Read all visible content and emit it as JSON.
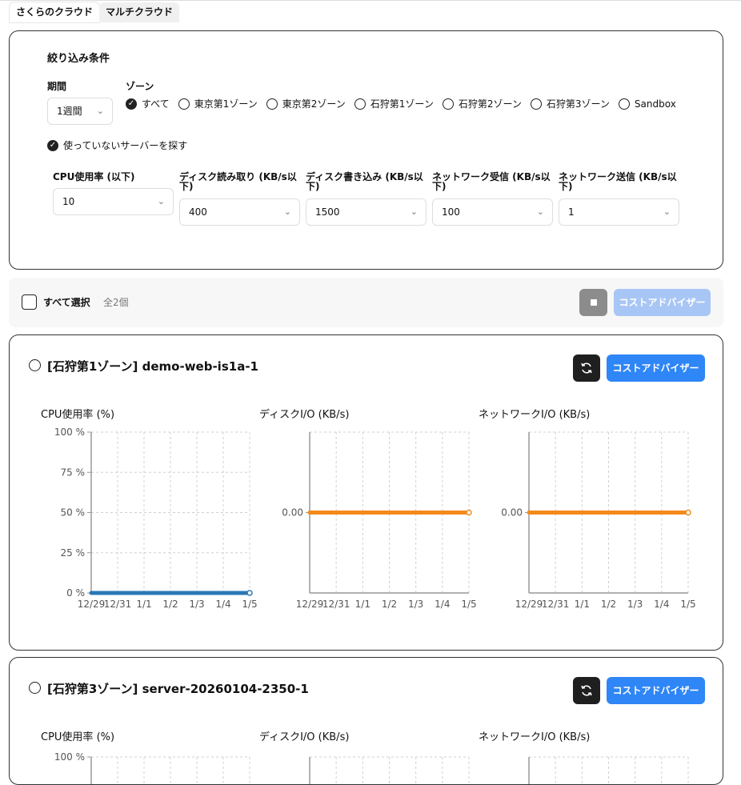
{
  "tabs": [
    {
      "label": "さくらのクラウド",
      "active": true
    },
    {
      "label": "マルチクラウド",
      "active": false
    }
  ],
  "filters": {
    "title": "絞り込み条件",
    "period": {
      "label": "期間",
      "value": "1週間"
    },
    "zone": {
      "label": "ゾーン",
      "options": [
        {
          "label": "すべて",
          "checked": true
        },
        {
          "label": "東京第1ゾーン",
          "checked": false
        },
        {
          "label": "東京第2ゾーン",
          "checked": false
        },
        {
          "label": "石狩第1ゾーン",
          "checked": false
        },
        {
          "label": "石狩第2ゾーン",
          "checked": false
        },
        {
          "label": "石狩第3ゾーン",
          "checked": false
        },
        {
          "label": "Sandbox",
          "checked": false
        }
      ]
    },
    "unused_servers": {
      "label": "使っていないサーバーを探す",
      "checked": true
    },
    "thresholds": [
      {
        "label_line1": "CPU使用率 (以下)",
        "label_line2": "",
        "value": "10"
      },
      {
        "label_line1": "ディスク読み取り (KB/s以",
        "label_line2": "下)",
        "value": "400"
      },
      {
        "label_line1": "ディスク書き込み (KB/s以",
        "label_line2": "下)",
        "value": "1500"
      },
      {
        "label_line1": "ネットワーク受信 (KB/s以",
        "label_line2": "下)",
        "value": "100"
      },
      {
        "label_line1": "ネットワーク送信 (KB/s以",
        "label_line2": "下)",
        "value": "1"
      }
    ]
  },
  "bulk": {
    "select_all_label": "すべて選択",
    "count_label": "全2個",
    "advisor_label": "コストアドバイザー"
  },
  "servers": [
    {
      "title": "[石狩第1ゾーン] demo-web-is1a-1",
      "advisor_label": "コストアドバイザー",
      "charts": [
        {
          "title": "CPU使用率 (%)",
          "y_ticks": [
            "100 %",
            "75 %",
            "50 %",
            "25 %",
            "0 %"
          ],
          "value": 0
        },
        {
          "title": "ディスクI/O (KB/s)",
          "y_ticks": [
            "0.00"
          ],
          "value": 0
        },
        {
          "title": "ネットワークI/O (KB/s)",
          "y_ticks": [
            "0.00"
          ],
          "value": 0
        }
      ]
    },
    {
      "title": "[石狩第3ゾーン] server-20260104-2350-1",
      "advisor_label": "コストアドバイザー",
      "charts": [
        {
          "title": "CPU使用率 (%)",
          "y_ticks": [
            "100 %"
          ]
        },
        {
          "title": "ディスクI/O (KB/s)",
          "y_ticks": []
        },
        {
          "title": "ネットワークI/O (KB/s)",
          "y_ticks": []
        }
      ]
    }
  ],
  "chart_data": [
    {
      "type": "line",
      "title": "CPU使用率 (%)",
      "x": [
        "12/29",
        "12/31",
        "1/1",
        "1/2",
        "1/3",
        "1/4",
        "1/5"
      ],
      "series": [
        {
          "values": [
            0,
            0,
            0,
            0,
            0,
            0,
            0
          ],
          "color": "#2a78b6"
        }
      ],
      "ylim": [
        0,
        100
      ]
    },
    {
      "type": "line",
      "title": "ディスクI/O (KB/s)",
      "x": [
        "12/29",
        "12/31",
        "1/1",
        "1/2",
        "1/3",
        "1/4",
        "1/5"
      ],
      "series": [
        {
          "values": [
            0,
            0,
            0,
            0,
            0,
            0,
            0
          ],
          "color": "#f48a1c"
        }
      ]
    },
    {
      "type": "line",
      "title": "ネットワークI/O (KB/s)",
      "x": [
        "12/29",
        "12/31",
        "1/1",
        "1/2",
        "1/3",
        "1/4",
        "1/5"
      ],
      "series": [
        {
          "values": [
            0,
            0,
            0,
            0,
            0,
            0,
            0
          ],
          "color": "#f48a1c"
        }
      ]
    }
  ]
}
